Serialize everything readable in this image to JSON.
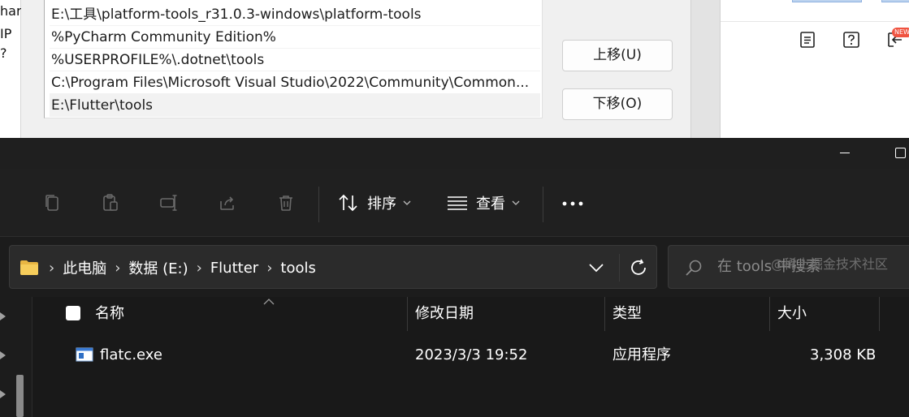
{
  "env_dialog": {
    "left_fragments": [
      "har",
      "IP",
      "?"
    ],
    "path_items": [
      "E:\\工具\\platform-tools_r31.0.3-windows\\platform-tools",
      "%PyCharm Community Edition%",
      "%USERPROFILE%\\.dotnet\\tools",
      "C:\\Program Files\\Microsoft Visual Studio\\2022\\Community\\Common...",
      "E:\\Flutter\\tools"
    ],
    "selected_index": 4,
    "move_up_label": "上移(U)",
    "move_down_label": "下移(O)"
  },
  "right_app": {
    "icons": [
      "document-icon",
      "help-icon",
      "back-arrow-icon"
    ],
    "badge": "NEW"
  },
  "explorer": {
    "toolbar": {
      "icons": [
        "copy-icon",
        "paste-icon",
        "rename-icon",
        "share-icon",
        "delete-icon"
      ],
      "sort_label": "排序",
      "view_label": "查看",
      "more_label": "···"
    },
    "address": {
      "crumbs": [
        "此电脑",
        "数据 (E:)",
        "Flutter",
        "tools"
      ],
      "separator": "›"
    },
    "search": {
      "placeholder": "在 tools 中搜索"
    },
    "columns": {
      "name": "名称",
      "modified": "修改日期",
      "type": "类型",
      "size": "大小"
    },
    "files": [
      {
        "name": "flatc.exe",
        "modified": "2023/3/3 19:52",
        "type": "应用程序",
        "size": "3,308 KB"
      }
    ]
  },
  "watermark": "@稀土掘金技术社区"
}
